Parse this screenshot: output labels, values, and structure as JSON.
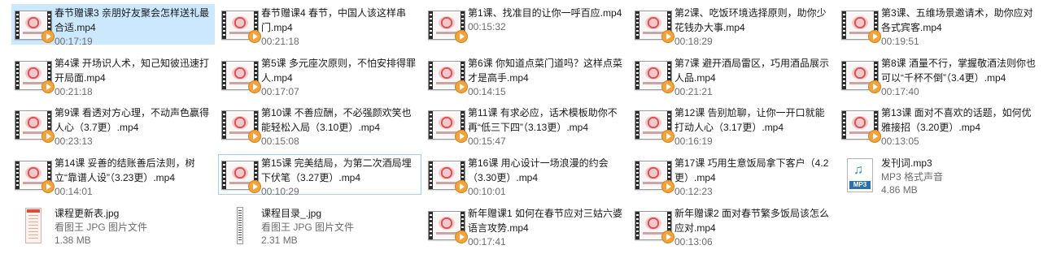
{
  "files": [
    {
      "name": "春节赠课3 亲朋好友聚会怎样送礼最合适.mp4",
      "meta1": "00:17:19",
      "meta2": "",
      "type": "video",
      "state": "selected"
    },
    {
      "name": "春节赠课4 春节，中国人该这样串门.mp4",
      "meta1": "00:21:18",
      "meta2": "",
      "type": "video",
      "state": ""
    },
    {
      "name": "第1课、找准目的让你一呼百应.mp4",
      "meta1": "00:15:32",
      "meta2": "",
      "type": "video",
      "state": ""
    },
    {
      "name": "第2课、吃饭环境选择原则，助你少花钱办大事.mp4",
      "meta1": "00:18:29",
      "meta2": "",
      "type": "video",
      "state": ""
    },
    {
      "name": "第3课、五维场景邀请术，助你应对各式宾客.mp4",
      "meta1": "00:19:51",
      "meta2": "",
      "type": "video",
      "state": ""
    },
    {
      "name": "第4课 开场识人术，知己知彼迅速打开局面.mp4",
      "meta1": "00:21:18",
      "meta2": "",
      "type": "video",
      "state": ""
    },
    {
      "name": "第5课 多元座次原则，不怕安排得罪人.mp4",
      "meta1": "00:17:07",
      "meta2": "",
      "type": "video",
      "state": ""
    },
    {
      "name": "第6课 你知道点菜门道吗？这样点菜才是高手.mp4",
      "meta1": "00:14:15",
      "meta2": "",
      "type": "video",
      "state": ""
    },
    {
      "name": "第7课 避开酒局雷区，巧用酒品展示人品.mp4",
      "meta1": "00:21:21",
      "meta2": "",
      "type": "video",
      "state": ""
    },
    {
      "name": "第8课 酒量不行，掌握敬酒法则你也可以“千杯不倒”（3.4更）.mp4",
      "meta1": "00:17:40",
      "meta2": "",
      "type": "video",
      "state": ""
    },
    {
      "name": "第9课 看透对方心理，不动声色赢得人心（3.7更）.mp4",
      "meta1": "00:23:13",
      "meta2": "",
      "type": "video",
      "state": ""
    },
    {
      "name": "第10课 不善应酬，不必强颜欢笑也能轻松入局（3.10更）.mp4",
      "meta1": "00:15:08",
      "meta2": "",
      "type": "video",
      "state": ""
    },
    {
      "name": "第11课 有求必应，话术模板助你不再“低三下四”（3.13更）.mp4",
      "meta1": "00:15:47",
      "meta2": "",
      "type": "video",
      "state": ""
    },
    {
      "name": "第12课 告别尬聊，让你一开口就能打动人心（3.17更）.mp4",
      "meta1": "00:16:19",
      "meta2": "",
      "type": "video",
      "state": ""
    },
    {
      "name": "第13课 面对不喜欢的话题，如何优雅接招（3.20更）.mp4",
      "meta1": "00:13:05",
      "meta2": "",
      "type": "video",
      "state": ""
    },
    {
      "name": "第14课 妥善的结账善后法则，树立“靠谱人设”（3.23更）.mp4",
      "meta1": "00:14:01",
      "meta2": "",
      "type": "video",
      "state": ""
    },
    {
      "name": "第15课 完美结局，为第二次酒局埋下伏笔（3.27更）.mp4",
      "meta1": "00:10:29",
      "meta2": "",
      "type": "video",
      "state": "focused"
    },
    {
      "name": "第16课 用心设计一场浪漫的约会（3.30更）.mp4",
      "meta1": "00:10:01",
      "meta2": "",
      "type": "video",
      "state": ""
    },
    {
      "name": "第17课 巧用生意饭局拿下客户（4.2更）.mp4",
      "meta1": "00:12:23",
      "meta2": "",
      "type": "video",
      "state": ""
    },
    {
      "name": "发刊词.mp3",
      "meta1": "MP3 格式声音",
      "meta2": "4.86 MB",
      "type": "mp3",
      "state": ""
    },
    {
      "name": "课程更新表.jpg",
      "meta1": "看图王 JPG 图片文件",
      "meta2": "1.38 MB",
      "type": "jpg1",
      "state": ""
    },
    {
      "name": "课程目录_.jpg",
      "meta1": "看图王 JPG 图片文件",
      "meta2": "2.31 MB",
      "type": "jpg2",
      "state": ""
    },
    {
      "name": "新年赠课1 如何在春节应对三姑六婆语言攻势.mp4",
      "meta1": "00:17:41",
      "meta2": "",
      "type": "video",
      "state": ""
    },
    {
      "name": "新年赠课2 面对春节繁多饭局该怎么应对.mp4",
      "meta1": "00:13:06",
      "meta2": "",
      "type": "video",
      "state": ""
    }
  ],
  "colors": {
    "selected_bg": "#cce8ff",
    "focus_border": "#99d1ff",
    "play_button": "#f2a33a",
    "meta_text": "#6d6d6d"
  },
  "icons": {
    "video": "video-file-icon",
    "mp3": "mp3-file-icon",
    "jpg1": "jpg-file-icon",
    "jpg2": "jpg-file-icon"
  }
}
